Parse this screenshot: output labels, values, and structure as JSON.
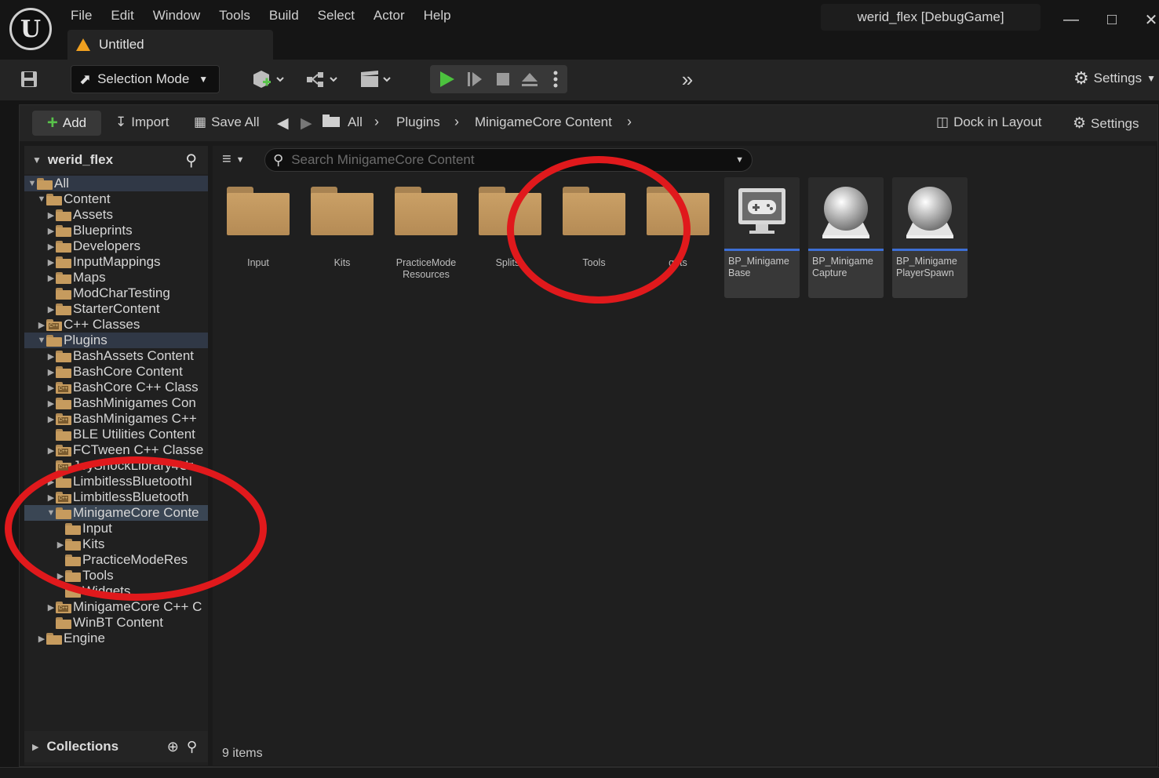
{
  "app": {
    "menu": [
      "File",
      "Edit",
      "Window",
      "Tools",
      "Build",
      "Select",
      "Actor",
      "Help"
    ],
    "window_title": "werid_flex [DebugGame]",
    "doc_tab": "Untitled",
    "mode_label": "Selection Mode",
    "toolbar_settings": "Settings"
  },
  "content_browser": {
    "toolbar": {
      "add": "Add",
      "import": "Import",
      "save_all": "Save All",
      "breadcrumbs": [
        "All",
        "Plugins",
        "MinigameCore Content"
      ],
      "dock": "Dock in Layout",
      "settings": "Settings"
    },
    "tree_header": "werid_flex",
    "collections": "Collections",
    "search_placeholder": "Search MinigameCore Content",
    "items_count": "9 items",
    "tree": [
      {
        "label": "All"
      },
      {
        "label": "Content"
      },
      {
        "label": "Assets"
      },
      {
        "label": "Blueprints"
      },
      {
        "label": "Developers"
      },
      {
        "label": "InputMappings"
      },
      {
        "label": "Maps"
      },
      {
        "label": "ModCharTesting"
      },
      {
        "label": "StarterContent"
      },
      {
        "label": "C++ Classes"
      },
      {
        "label": "Plugins"
      },
      {
        "label": "BashAssets Content"
      },
      {
        "label": "BashCore Content"
      },
      {
        "label": "BashCore C++ Class"
      },
      {
        "label": "BashMinigames Con"
      },
      {
        "label": "BashMinigames C++"
      },
      {
        "label": "BLE Utilities Content"
      },
      {
        "label": "FCTween C++ Classe"
      },
      {
        "label": "JoyShockLibrary4Ur"
      },
      {
        "label": "LimbitlessBluetoothI"
      },
      {
        "label": "LimbitlessBluetooth"
      },
      {
        "label": "MinigameCore Conte"
      },
      {
        "label": "Input"
      },
      {
        "label": "Kits"
      },
      {
        "label": "PracticeModeRes"
      },
      {
        "label": "Tools"
      },
      {
        "label": "Widgets"
      },
      {
        "label": "MinigameCore C++ C"
      },
      {
        "label": "WinBT Content"
      },
      {
        "label": "Engine"
      }
    ],
    "folders": [
      "Input",
      "Kits",
      "PracticeMode Resources",
      "Splitsc",
      "Tools",
      "gets"
    ],
    "blueprints": [
      "BP_Minigame Base",
      "BP_Minigame Capture",
      "BP_Minigame PlayerSpawn"
    ]
  }
}
